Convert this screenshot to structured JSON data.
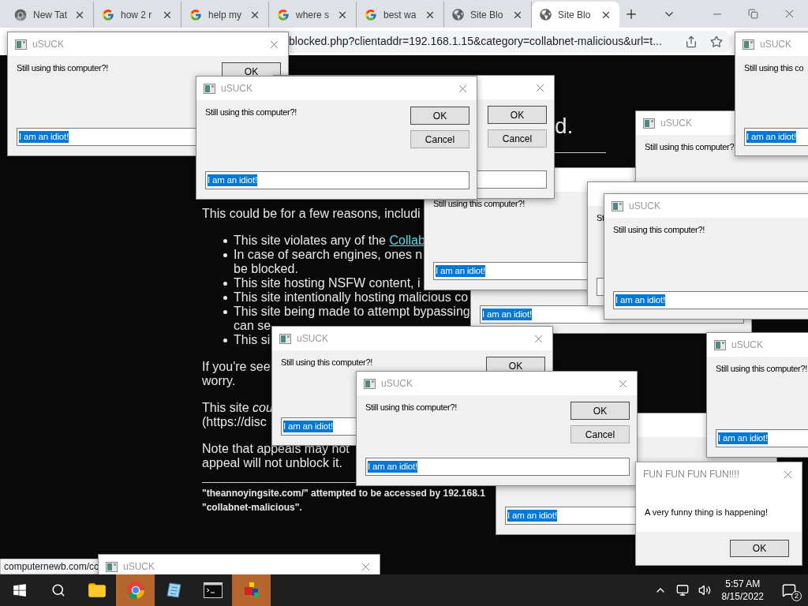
{
  "browser": {
    "tabs": [
      {
        "label": "New Tat",
        "kind": "chrome",
        "selected": false
      },
      {
        "label": "how 2 r",
        "kind": "google",
        "selected": false
      },
      {
        "label": "help my",
        "kind": "google",
        "selected": false
      },
      {
        "label": "where s",
        "kind": "google",
        "selected": false
      },
      {
        "label": "best wa",
        "kind": "google",
        "selected": false
      },
      {
        "label": "Site Blo",
        "kind": "globe",
        "selected": false
      },
      {
        "label": "Site Blo",
        "kind": "globe",
        "selected": true
      }
    ],
    "address": "blocked.php?clientaddr=192.168.1.15&category=collabnet-malicious&url=t...",
    "page": {
      "heading": "d.",
      "intro": "This could be for a few reasons, includi",
      "reasons": [
        {
          "lines": [
            "This site violates any of the "
          ],
          "link": "Collab"
        },
        {
          "lines": [
            "In case of search engines, ones n",
            "be blocked."
          ]
        },
        {
          "lines": [
            "This site hosting NSFW content, i"
          ]
        },
        {
          "lines": [
            "This site intentionally hosting malicious co"
          ]
        },
        {
          "lines": [
            "This site being made to attempt bypassing",
            "can se"
          ]
        },
        {
          "lines": [
            "This si"
          ]
        }
      ],
      "paragraphs": [
        [
          "If you're see",
          "worry."
        ],
        [
          "This site *cou*",
          "(https://disc"
        ],
        [
          "Note that appeals may not",
          "appeal will not unblock it."
        ]
      ],
      "footer": [
        "\"theannoyingsite.com/\" attempted to be accessed by 192.168.1",
        "\"collabnet-malicious\"."
      ]
    },
    "status_url": "computernewb.com/cc"
  },
  "dialogs": [
    {
      "kind": "prompt",
      "title": "uSUCK",
      "message": "Still using this computer?!",
      "ok": "OK",
      "input": "I am an idiot!"
    },
    {
      "kind": "prompt",
      "title": "uSUCK",
      "message": "Still using this co",
      "input": "I am an idiot!"
    },
    {
      "kind": "prompt",
      "title": "uSUCK",
      "message": "Still using this computer?!",
      "ok": "OK",
      "cancel": "Cancel",
      "input": "I am an idiot!"
    },
    {
      "kind": "prompt",
      "ok": "OK",
      "cancel": "Cancel"
    },
    {
      "kind": "prompt",
      "title": "uSUCK",
      "message": "Still using this computer?"
    },
    {
      "kind": "prompt",
      "message": "Still using this computer?!",
      "input": "I am an idiot!"
    },
    {
      "kind": "prompt",
      "message": "St"
    },
    {
      "kind": "prompt",
      "title": "uSUCK",
      "message": "Still using this computer?!",
      "input": "I am an idiot!"
    },
    {
      "kind": "prompt",
      "input": "I am an idiot!"
    },
    {
      "kind": "prompt",
      "title": "uSUCK",
      "message": "Still using this computer?!",
      "ok": "OK",
      "input": "I am an idiot!"
    },
    {
      "kind": "prompt",
      "title": "uSUCK",
      "message": "Still using this computer?!",
      "input": "I am an idiot!"
    },
    {
      "kind": "prompt",
      "title": "uSUCK",
      "message": "Still using this computer?!",
      "ok": "OK",
      "cancel": "Cancel",
      "input": "I am an idiot!"
    },
    {
      "kind": "prompt",
      "input": "I am an idiot!"
    },
    {
      "kind": "alert",
      "title": "FUN FUN FUN FUN!!!!",
      "message": "A very funny thing is happening!",
      "ok": "OK"
    },
    {
      "kind": "prompt",
      "title": "uSUCK"
    }
  ],
  "taskbar": {
    "apps": [
      {
        "kind": "start",
        "flashing": false
      },
      {
        "kind": "search",
        "flashing": false
      },
      {
        "kind": "folder",
        "flashing": false
      },
      {
        "kind": "chrome",
        "flashing": true
      },
      {
        "kind": "pen",
        "flashing": false
      },
      {
        "kind": "terminal",
        "flashing": false
      },
      {
        "kind": "cube",
        "flashing": true
      }
    ],
    "time": "5:57 AM",
    "date": "8/15/2022",
    "notifications": "2"
  }
}
